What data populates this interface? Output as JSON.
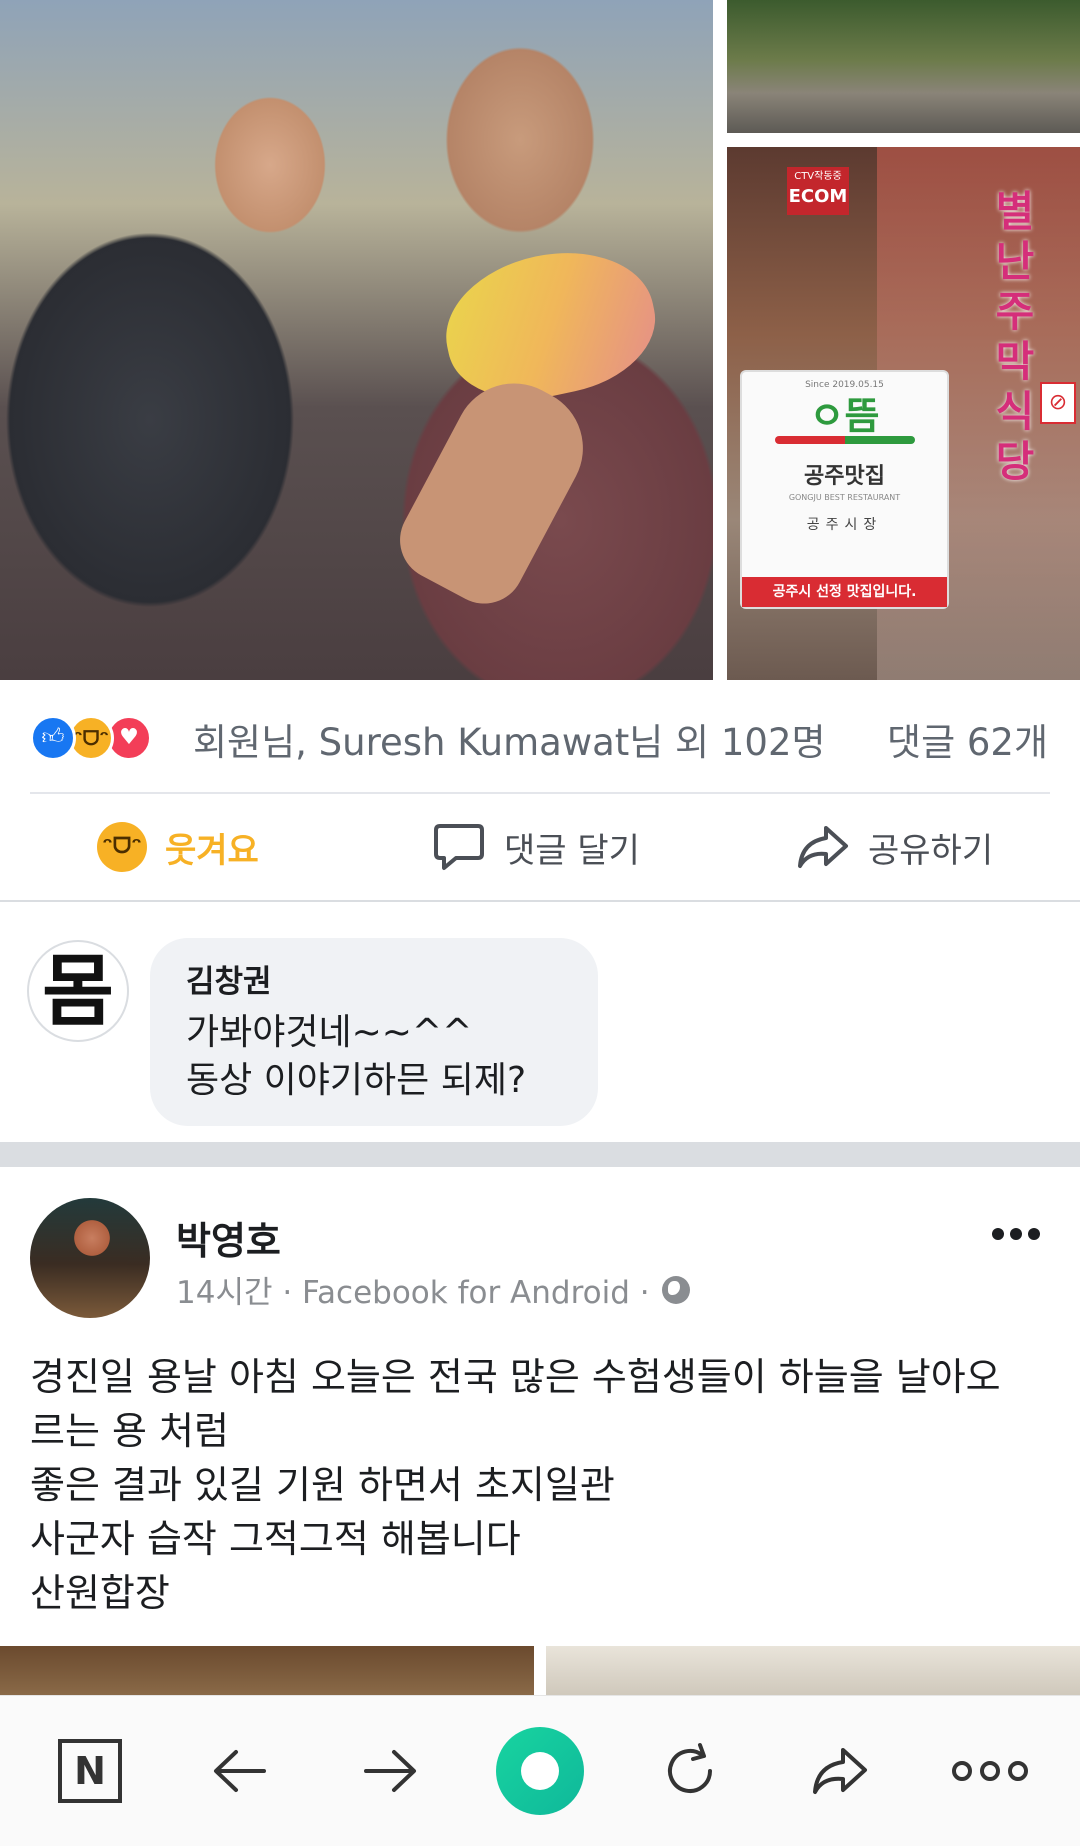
{
  "photos": {
    "sign": {
      "since": "Since 2019.05.15",
      "logo": "ㅇ뜸",
      "name": "공주맛집",
      "eng": "GONGJU BEST RESTAURANT",
      "city": "공주시장",
      "banner": "공주시 선정 맛집입니다."
    },
    "shop_badge_small": "CTV작동중",
    "shop_badge_big": "ECOM",
    "side_text": [
      "별",
      "난",
      "주",
      "막",
      "식",
      "당"
    ]
  },
  "reactions": {
    "text": "회원님, Suresh Kumawat님 외 102명",
    "comment_count": "댓글 62개"
  },
  "actions": {
    "laugh": "웃겨요",
    "comment": "댓글 달기",
    "share": "공유하기"
  },
  "comment": {
    "avatar_glyph": "몸",
    "author": "김창권",
    "lines": [
      "가봐야것네~~^^",
      "동상 이야기하믄 되제?"
    ]
  },
  "post": {
    "author": "박영호",
    "meta": "14시간 · Facebook for Android ·",
    "lines": [
      "경진일 용날 아침 오늘은 전국 많은 수험생들이 하늘을 날아오",
      "르는 용 처럼",
      "좋은 결과 있길 기원 하면서 초지일관",
      "사군자 습작 그적그적 해봅니다",
      "산원합장"
    ]
  },
  "toolbar": {
    "n_label": "N"
  },
  "colors": {
    "laugh_accent": "#f7b125",
    "like_blue": "#1877f2",
    "love_red": "#f33e58",
    "home_green": "#18d4a0"
  }
}
